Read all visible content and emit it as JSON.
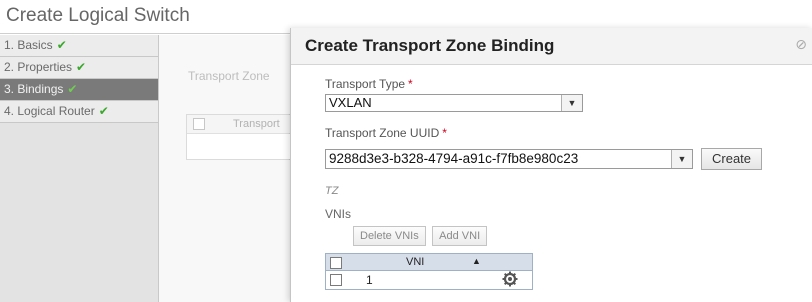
{
  "background": {
    "title": "Create Logical Switch",
    "wizard_steps": [
      {
        "label": "1. Basics",
        "done": true,
        "active": false
      },
      {
        "label": "2. Properties",
        "done": true,
        "active": false
      },
      {
        "label": "3. Bindings",
        "done": true,
        "active": true
      },
      {
        "label": "4. Logical Router",
        "done": true,
        "active": false
      }
    ],
    "transport_zone_label": "Transport Zone",
    "grid_column": "Transport"
  },
  "modal": {
    "title": "Create Transport Zone Binding",
    "transport_type_label": "Transport Type",
    "transport_type_value": "VXLAN",
    "uuid_label": "Transport Zone UUID",
    "uuid_value": "9288d3e3-b328-4794-a91c-f7fb8e980c23",
    "create_label": "Create",
    "tz_note": "TZ",
    "vnis_label": "VNIs",
    "delete_vnis_label": "Delete VNIs",
    "add_vni_label": "Add VNI",
    "table": {
      "column": "VNI",
      "rows": [
        {
          "value": "1"
        }
      ]
    }
  },
  "icons": {
    "checkmark": "check-icon",
    "dropdown": "chevron-down-icon",
    "sort": "sort-up-icon",
    "settings": "gear-icon"
  }
}
